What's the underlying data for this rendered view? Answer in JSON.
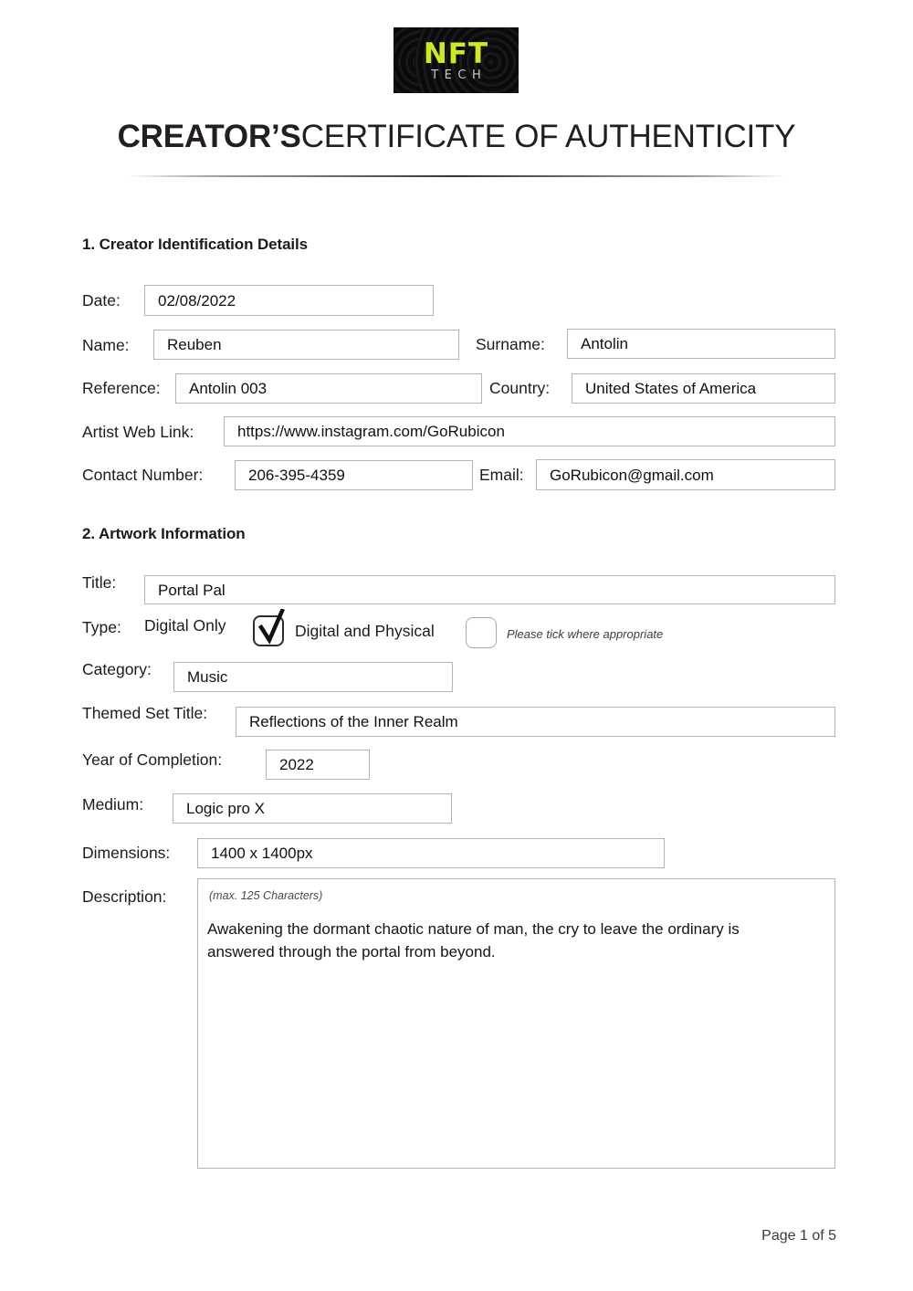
{
  "logo": {
    "primary_text": "NFT",
    "secondary_text": "TECH",
    "primary_color": "#cfe62b",
    "secondary_color": "#c9c9c9",
    "background_color": "#090909"
  },
  "header": {
    "title_bold": "CREATOR’S",
    "title_rest": "CERTIFICATE OF AUTHENTICITY"
  },
  "section1": {
    "heading": "1. Creator Identification Details",
    "fields": {
      "date_label": "Date:",
      "date_value": "02/08/2022",
      "name_label": "Name:",
      "name_value": "Reuben",
      "surname_label": "Surname:",
      "surname_value": "Antolin",
      "reference_label": "Reference:",
      "reference_value": "Antolin 003",
      "country_label": "Country:",
      "country_value": "United States of America",
      "weblink_label": "Artist Web Link:",
      "weblink_value": "https://www.instagram.com/GoRubicon",
      "contact_label": "Contact Number:",
      "contact_value": "206-395-4359",
      "email_label": "Email:",
      "email_value": "GoRubicon@gmail.com"
    }
  },
  "section2": {
    "heading": "2. Artwork Information",
    "fields": {
      "title_label": "Title:",
      "title_value": "Portal Pal",
      "type_label": "Type:",
      "type_option_digital_only": "Digital Only",
      "type_option_digital_and_physical": "Digital and Physical",
      "type_hint": "Please tick where appropriate",
      "type_digital_only_checked": "true",
      "type_digital_and_physical_checked": "false",
      "category_label": "Category:",
      "category_value": "Music",
      "themed_set_label": "Themed Set Title:",
      "themed_set_value": "Reflections of the Inner Realm",
      "year_label": "Year of Completion:",
      "year_value": "2022",
      "medium_label": "Medium:",
      "medium_value": "Logic pro X",
      "dimensions_label": "Dimensions:",
      "dimensions_value": "1400 x 1400px",
      "description_label": "Description:",
      "description_note": "(max. 125 Characters)",
      "description_value": "Awakening the dormant chaotic nature of man, the cry to leave the ordinary is answered through the portal from beyond."
    }
  },
  "footer": {
    "page_indicator": "Page 1 of 5"
  }
}
